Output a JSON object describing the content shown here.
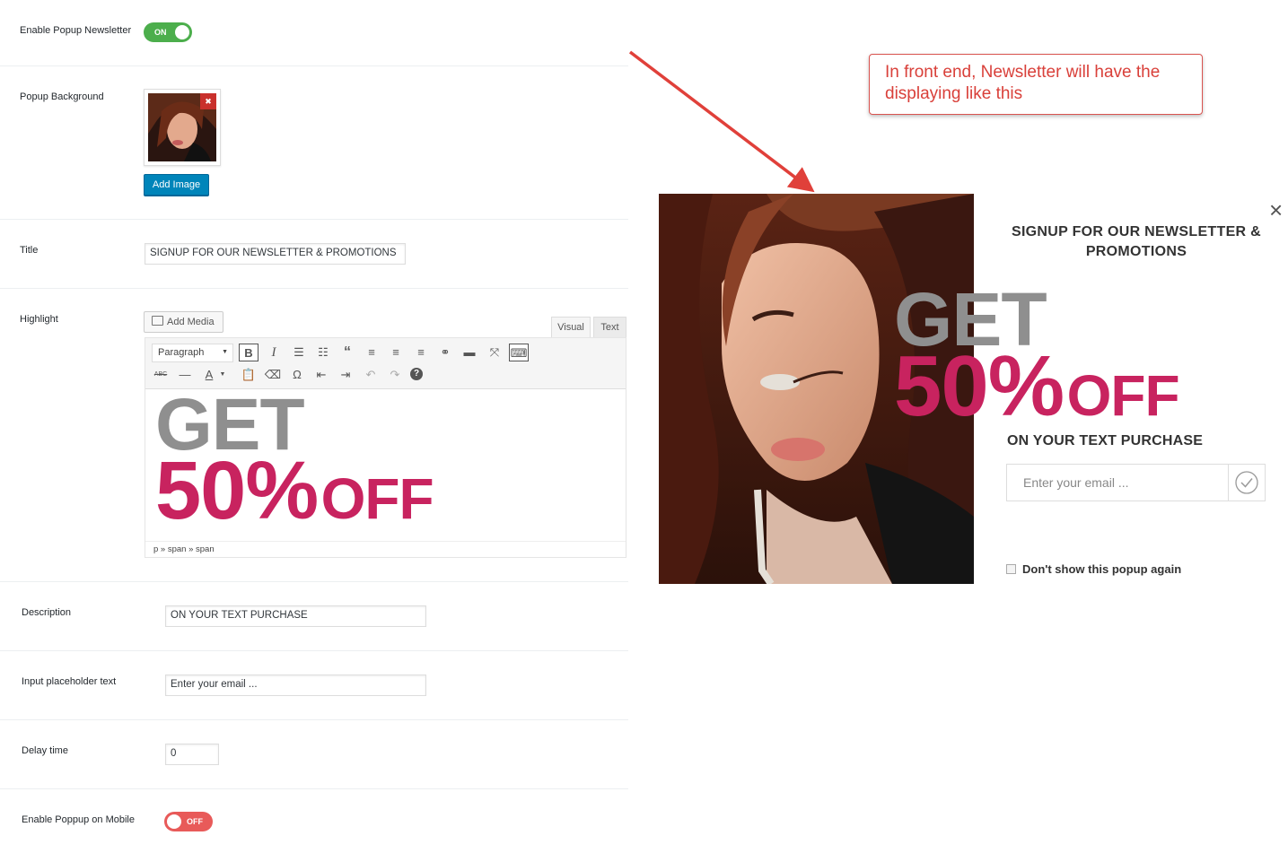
{
  "settings": {
    "enable_popup": {
      "label": "Enable Popup Newsletter",
      "toggle": "ON"
    },
    "popup_background": {
      "label": "Popup Background",
      "remove_icon": "✖",
      "add_image_button": "Add Image"
    },
    "title": {
      "label": "Title",
      "value": "SIGNUP FOR OUR NEWSLETTER & PROMOTIONS"
    },
    "highlight": {
      "label": "Highlight",
      "add_media": "Add Media",
      "tabs": {
        "visual": "Visual",
        "text": "Text"
      },
      "format_select": "Paragraph",
      "content_line1": "GET",
      "content_line2_big": "50%",
      "content_line2_off": "OFF",
      "status_path": "p » span » span"
    },
    "description": {
      "label": "Description",
      "value": "ON YOUR TEXT PURCHASE"
    },
    "placeholder_text": {
      "label": "Input placeholder text",
      "value": "Enter your email ..."
    },
    "delay_time": {
      "label": "Delay time",
      "value": "0"
    },
    "enable_mobile": {
      "label": "Enable Poppup on Mobile",
      "toggle": "OFF"
    }
  },
  "annotation": {
    "text": "In front end, Newsletter will have the displaying like this"
  },
  "popup": {
    "close_icon": "×",
    "title": "SIGNUP FOR OUR NEWSLETTER & PROMOTIONS",
    "get": "GET",
    "percent": "50%",
    "off": "OFF",
    "description": "ON YOUR TEXT PURCHASE",
    "email_placeholder": "Enter your email ...",
    "dont_show": "Don't show this popup again"
  },
  "colors": {
    "toggle_on": "#4cae4c",
    "toggle_off": "#e85a59",
    "accent_pink": "#c8235f",
    "gray_text": "#8f8f8f",
    "button_blue": "#0085ba",
    "annotation_red": "#d9403a"
  }
}
